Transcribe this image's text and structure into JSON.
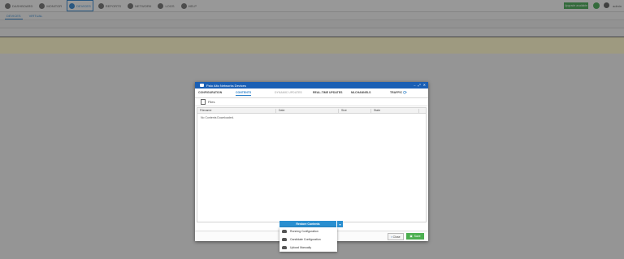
{
  "topnav": {
    "items": [
      {
        "label": "DASHBOARD",
        "icon": "dashboard-icon"
      },
      {
        "label": "MONITOR",
        "icon": "monitor-icon"
      },
      {
        "label": "DEVICES",
        "icon": "devices-icon"
      },
      {
        "label": "REPORTS",
        "icon": "reports-icon"
      },
      {
        "label": "NETWORK",
        "icon": "network-icon"
      },
      {
        "label": "LOGS",
        "icon": "logs-icon"
      },
      {
        "label": "HELP",
        "icon": "help-icon"
      }
    ],
    "upgrade_label": "Upgrade available",
    "user": "admin"
  },
  "subnav": {
    "tabs": [
      "DEVICES",
      "VIRTUAL"
    ]
  },
  "dialog": {
    "title": "Palo Alto Networks Devices",
    "tabs": [
      "CONFIGURATION",
      "CONTENTS",
      "DYNAMIC UPDATES",
      "REAL-TIME UPDATES",
      "MLCHANNELS",
      "TRAFFIC"
    ],
    "section": "Files",
    "columns": [
      "Filename",
      "Date",
      "Size",
      "State"
    ],
    "empty_text": "No Contents Downloaded.",
    "close_label": "Close",
    "save_label": "Save"
  },
  "restore": {
    "label": "Restore Contents",
    "options": [
      "Running Configuration",
      "Candidate Configuration",
      "Upload Manually"
    ]
  }
}
